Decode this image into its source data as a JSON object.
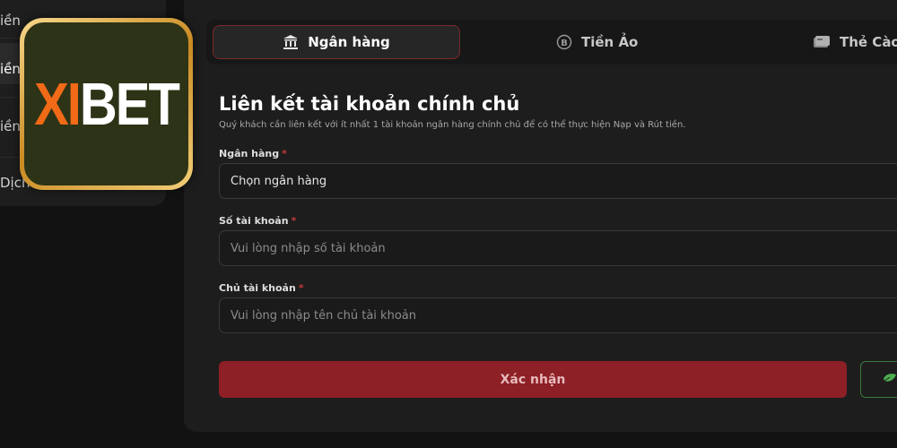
{
  "sidebar": {
    "items": [
      {
        "label": "iền"
      },
      {
        "label": "iền"
      },
      {
        "label": "iền N"
      },
      {
        "label": "Dịch v"
      }
    ]
  },
  "logo": {
    "part1": "XI",
    "part2": "BET"
  },
  "tabs": [
    {
      "label": "Ngân hàng",
      "icon": "bank-icon",
      "active": true
    },
    {
      "label": "Tiền Ảo",
      "icon": "coin-icon",
      "active": false
    },
    {
      "label": "Thẻ Cào",
      "icon": "card-icon",
      "active": false
    }
  ],
  "form": {
    "title": "Liên kết tài khoản chính chủ",
    "subtitle": "Quý khách cần liên kết với ít nhất 1 tài khoản ngân hàng chính chủ để có thể thực hiện Nạp và Rút tiền.",
    "bank": {
      "label": "Ngân hàng",
      "required_mark": "*",
      "value": "Chọn ngân hàng"
    },
    "account_number": {
      "label": "Số tài khoản",
      "required_mark": "*",
      "placeholder": "Vui lòng nhập số tài khoản"
    },
    "account_holder": {
      "label": "Chủ tài khoản",
      "required_mark": "*",
      "placeholder": "Vui lòng nhập tên chủ tài khoản"
    },
    "confirm_label": "Xác nhận"
  },
  "colors": {
    "accent": "#8d1f26",
    "logo_orange": "#f06a17",
    "logo_bg": "#2d3316",
    "support_green": "#3b7a3b"
  }
}
